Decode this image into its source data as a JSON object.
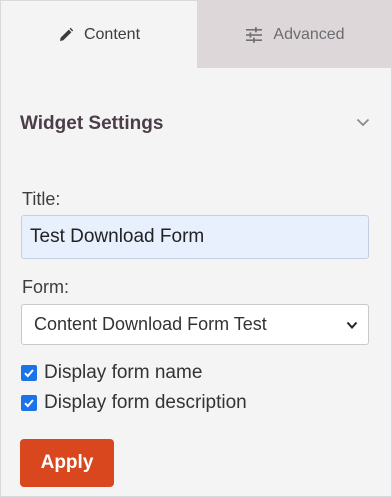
{
  "tabs": [
    {
      "label": "Content",
      "icon": "pencil-icon",
      "active": true
    },
    {
      "label": "Advanced",
      "icon": "sliders-icon",
      "active": false
    }
  ],
  "section": {
    "title": "Widget Settings",
    "toggle_icon": "chevron-down-icon"
  },
  "fields": {
    "title_label": "Title:",
    "title_value": "Test Download Form",
    "form_label": "Form:",
    "form_selected": "Content Download Form Test"
  },
  "options": [
    {
      "label": "Display form name",
      "checked": true
    },
    {
      "label": "Display form description",
      "checked": true
    }
  ],
  "actions": {
    "apply_label": "Apply"
  },
  "colors": {
    "accent_button": "#d9471e",
    "checkbox": "#1a73e8",
    "input_fill": "#e8f0fe",
    "inactive_tab": "#ddd7da"
  }
}
